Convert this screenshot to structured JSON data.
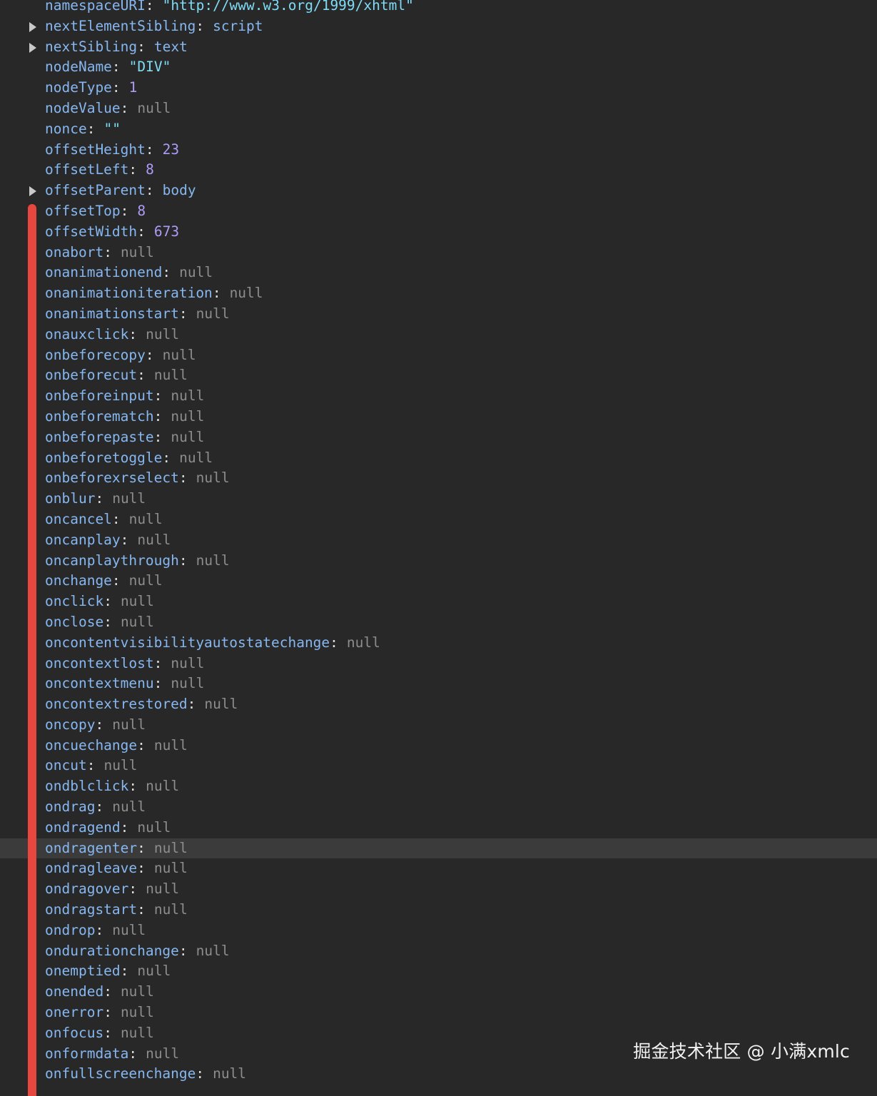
{
  "rows": [
    {
      "key": "namespaceURI",
      "value": "\"http://www.w3.org/1999/xhtml\"",
      "kind": "str",
      "expandable": false
    },
    {
      "key": "nextElementSibling",
      "value": "script",
      "kind": "obj",
      "expandable": true
    },
    {
      "key": "nextSibling",
      "value": "text",
      "kind": "obj",
      "expandable": true
    },
    {
      "key": "nodeName",
      "value": "\"DIV\"",
      "kind": "str",
      "expandable": false
    },
    {
      "key": "nodeType",
      "value": "1",
      "kind": "num",
      "expandable": false
    },
    {
      "key": "nodeValue",
      "value": "null",
      "kind": "null",
      "expandable": false
    },
    {
      "key": "nonce",
      "value": "\"\"",
      "kind": "str",
      "expandable": false
    },
    {
      "key": "offsetHeight",
      "value": "23",
      "kind": "num",
      "expandable": false
    },
    {
      "key": "offsetLeft",
      "value": "8",
      "kind": "num",
      "expandable": false
    },
    {
      "key": "offsetParent",
      "value": "body",
      "kind": "obj",
      "expandable": true
    },
    {
      "key": "offsetTop",
      "value": "8",
      "kind": "num",
      "expandable": false
    },
    {
      "key": "offsetWidth",
      "value": "673",
      "kind": "num",
      "expandable": false
    },
    {
      "key": "onabort",
      "value": "null",
      "kind": "null",
      "expandable": false
    },
    {
      "key": "onanimationend",
      "value": "null",
      "kind": "null",
      "expandable": false
    },
    {
      "key": "onanimationiteration",
      "value": "null",
      "kind": "null",
      "expandable": false
    },
    {
      "key": "onanimationstart",
      "value": "null",
      "kind": "null",
      "expandable": false
    },
    {
      "key": "onauxclick",
      "value": "null",
      "kind": "null",
      "expandable": false
    },
    {
      "key": "onbeforecopy",
      "value": "null",
      "kind": "null",
      "expandable": false
    },
    {
      "key": "onbeforecut",
      "value": "null",
      "kind": "null",
      "expandable": false
    },
    {
      "key": "onbeforeinput",
      "value": "null",
      "kind": "null",
      "expandable": false
    },
    {
      "key": "onbeforematch",
      "value": "null",
      "kind": "null",
      "expandable": false
    },
    {
      "key": "onbeforepaste",
      "value": "null",
      "kind": "null",
      "expandable": false
    },
    {
      "key": "onbeforetoggle",
      "value": "null",
      "kind": "null",
      "expandable": false
    },
    {
      "key": "onbeforexrselect",
      "value": "null",
      "kind": "null",
      "expandable": false
    },
    {
      "key": "onblur",
      "value": "null",
      "kind": "null",
      "expandable": false
    },
    {
      "key": "oncancel",
      "value": "null",
      "kind": "null",
      "expandable": false
    },
    {
      "key": "oncanplay",
      "value": "null",
      "kind": "null",
      "expandable": false
    },
    {
      "key": "oncanplaythrough",
      "value": "null",
      "kind": "null",
      "expandable": false
    },
    {
      "key": "onchange",
      "value": "null",
      "kind": "null",
      "expandable": false
    },
    {
      "key": "onclick",
      "value": "null",
      "kind": "null",
      "expandable": false
    },
    {
      "key": "onclose",
      "value": "null",
      "kind": "null",
      "expandable": false
    },
    {
      "key": "oncontentvisibilityautostatechange",
      "value": "null",
      "kind": "null",
      "expandable": false
    },
    {
      "key": "oncontextlost",
      "value": "null",
      "kind": "null",
      "expandable": false
    },
    {
      "key": "oncontextmenu",
      "value": "null",
      "kind": "null",
      "expandable": false
    },
    {
      "key": "oncontextrestored",
      "value": "null",
      "kind": "null",
      "expandable": false
    },
    {
      "key": "oncopy",
      "value": "null",
      "kind": "null",
      "expandable": false
    },
    {
      "key": "oncuechange",
      "value": "null",
      "kind": "null",
      "expandable": false
    },
    {
      "key": "oncut",
      "value": "null",
      "kind": "null",
      "expandable": false
    },
    {
      "key": "ondblclick",
      "value": "null",
      "kind": "null",
      "expandable": false
    },
    {
      "key": "ondrag",
      "value": "null",
      "kind": "null",
      "expandable": false
    },
    {
      "key": "ondragend",
      "value": "null",
      "kind": "null",
      "expandable": false
    },
    {
      "key": "ondragenter",
      "value": "null",
      "kind": "null",
      "expandable": false,
      "highlighted": true
    },
    {
      "key": "ondragleave",
      "value": "null",
      "kind": "null",
      "expandable": false
    },
    {
      "key": "ondragover",
      "value": "null",
      "kind": "null",
      "expandable": false
    },
    {
      "key": "ondragstart",
      "value": "null",
      "kind": "null",
      "expandable": false
    },
    {
      "key": "ondrop",
      "value": "null",
      "kind": "null",
      "expandable": false
    },
    {
      "key": "ondurationchange",
      "value": "null",
      "kind": "null",
      "expandable": false
    },
    {
      "key": "onemptied",
      "value": "null",
      "kind": "null",
      "expandable": false
    },
    {
      "key": "onended",
      "value": "null",
      "kind": "null",
      "expandable": false
    },
    {
      "key": "onerror",
      "value": "null",
      "kind": "null",
      "expandable": false
    },
    {
      "key": "onfocus",
      "value": "null",
      "kind": "null",
      "expandable": false
    },
    {
      "key": "onformdata",
      "value": "null",
      "kind": "null",
      "expandable": false
    },
    {
      "key": "onfullscreenchange",
      "value": "null",
      "kind": "null",
      "expandable": false
    }
  ],
  "watermark": "掘金技术社区 @ 小满xmlc",
  "colors": {
    "key": "#86b7f0",
    "string": "#7fdcf6",
    "number": "#b09cf7",
    "null": "#8d8d8d",
    "selection_bar": "#e8473f",
    "background": "#282828",
    "row_highlight": "#3b3b3b"
  }
}
